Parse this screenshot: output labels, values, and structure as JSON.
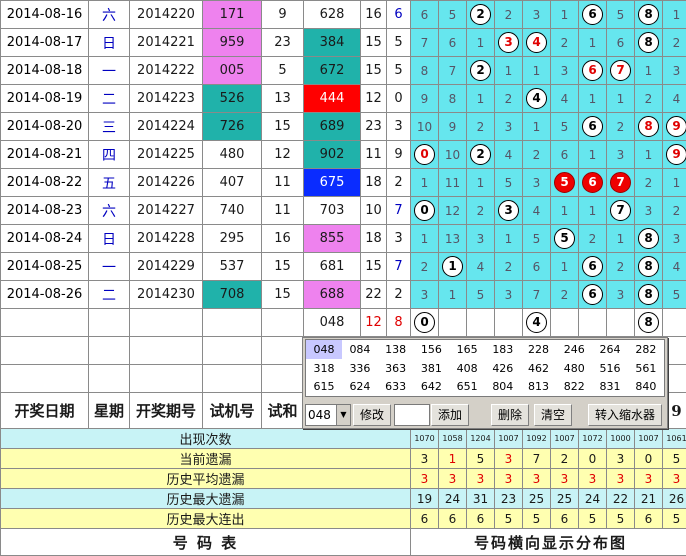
{
  "rows": [
    {
      "date": "2014-08-16",
      "week": "六",
      "issue": "2014220",
      "test": "171",
      "test_bg": "mg",
      "sum": "9",
      "draw": "628",
      "draw_bg": "",
      "span1": "16",
      "span2": "6",
      "span2_c": "blu",
      "cells": [
        [
          "6",
          ""
        ],
        [
          "5",
          ""
        ],
        [
          "2",
          "w"
        ],
        [
          "2",
          ""
        ],
        [
          "3",
          ""
        ],
        [
          "1",
          ""
        ],
        [
          "6",
          "w"
        ],
        [
          "5",
          ""
        ],
        [
          "8",
          "w"
        ],
        [
          "1",
          ""
        ]
      ]
    },
    {
      "date": "2014-08-17",
      "week": "日",
      "issue": "2014221",
      "test": "959",
      "test_bg": "mg",
      "sum": "23",
      "draw": "384",
      "draw_bg": "tl",
      "span1": "15",
      "span2": "5",
      "span2_c": "",
      "cells": [
        [
          "7",
          ""
        ],
        [
          "6",
          ""
        ],
        [
          "1",
          ""
        ],
        [
          "3",
          "wr"
        ],
        [
          "4",
          "wr"
        ],
        [
          "2",
          ""
        ],
        [
          "1",
          ""
        ],
        [
          "6",
          ""
        ],
        [
          "8",
          "w"
        ],
        [
          "2",
          ""
        ]
      ]
    },
    {
      "date": "2014-08-18",
      "week": "一",
      "issue": "2014222",
      "test": "005",
      "test_bg": "mg",
      "sum": "5",
      "draw": "672",
      "draw_bg": "tl",
      "span1": "15",
      "span2": "5",
      "span2_c": "",
      "cells": [
        [
          "8",
          ""
        ],
        [
          "7",
          ""
        ],
        [
          "2",
          "w"
        ],
        [
          "1",
          ""
        ],
        [
          "1",
          ""
        ],
        [
          "3",
          ""
        ],
        [
          "6",
          "wr"
        ],
        [
          "7",
          "wr"
        ],
        [
          "1",
          ""
        ],
        [
          "3",
          ""
        ]
      ]
    },
    {
      "date": "2014-08-19",
      "week": "二",
      "issue": "2014223",
      "test": "526",
      "test_bg": "tl",
      "sum": "13",
      "draw": "444",
      "draw_bg": "rd",
      "span1": "12",
      "span2": "0",
      "span2_c": "",
      "cells": [
        [
          "9",
          ""
        ],
        [
          "8",
          ""
        ],
        [
          "1",
          ""
        ],
        [
          "2",
          ""
        ],
        [
          "4",
          "w"
        ],
        [
          "4",
          ""
        ],
        [
          "1",
          ""
        ],
        [
          "1",
          ""
        ],
        [
          "2",
          ""
        ],
        [
          "4",
          ""
        ]
      ]
    },
    {
      "date": "2014-08-20",
      "week": "三",
      "issue": "2014224",
      "test": "726",
      "test_bg": "tl",
      "sum": "15",
      "draw": "689",
      "draw_bg": "tl",
      "span1": "23",
      "span2": "3",
      "span2_c": "",
      "cells": [
        [
          "10",
          ""
        ],
        [
          "9",
          ""
        ],
        [
          "2",
          ""
        ],
        [
          "3",
          ""
        ],
        [
          "1",
          ""
        ],
        [
          "5",
          ""
        ],
        [
          "6",
          "w"
        ],
        [
          "2",
          ""
        ],
        [
          "8",
          "wr"
        ],
        [
          "9",
          "wr"
        ]
      ]
    },
    {
      "date": "2014-08-21",
      "week": "四",
      "issue": "2014225",
      "test": "480",
      "test_bg": "",
      "sum": "12",
      "draw": "902",
      "draw_bg": "tl",
      "span1": "11",
      "span2": "9",
      "span2_c": "",
      "cells": [
        [
          "0",
          "wr"
        ],
        [
          "10",
          ""
        ],
        [
          "2",
          "w"
        ],
        [
          "4",
          ""
        ],
        [
          "2",
          ""
        ],
        [
          "6",
          ""
        ],
        [
          "1",
          ""
        ],
        [
          "3",
          ""
        ],
        [
          "1",
          ""
        ],
        [
          "9",
          "wr"
        ]
      ]
    },
    {
      "date": "2014-08-22",
      "week": "五",
      "issue": "2014226",
      "test": "407",
      "test_bg": "",
      "sum": "11",
      "draw": "675",
      "draw_bg": "bl",
      "span1": "18",
      "span2": "2",
      "span2_c": "",
      "cells": [
        [
          "1",
          ""
        ],
        [
          "11",
          ""
        ],
        [
          "1",
          ""
        ],
        [
          "5",
          ""
        ],
        [
          "3",
          ""
        ],
        [
          "5",
          "r"
        ],
        [
          "6",
          "r"
        ],
        [
          "7",
          "r"
        ],
        [
          "2",
          ""
        ],
        [
          "1",
          ""
        ]
      ]
    },
    {
      "date": "2014-08-23",
      "week": "六",
      "issue": "2014227",
      "test": "740",
      "test_bg": "",
      "sum": "11",
      "draw": "703",
      "draw_bg": "",
      "span1": "10",
      "span2": "7",
      "span2_c": "blu",
      "cells": [
        [
          "0",
          "w"
        ],
        [
          "12",
          ""
        ],
        [
          "2",
          ""
        ],
        [
          "3",
          "w"
        ],
        [
          "4",
          ""
        ],
        [
          "1",
          ""
        ],
        [
          "1",
          ""
        ],
        [
          "7",
          "w"
        ],
        [
          "3",
          ""
        ],
        [
          "2",
          ""
        ]
      ]
    },
    {
      "date": "2014-08-24",
      "week": "日",
      "issue": "2014228",
      "test": "295",
      "test_bg": "",
      "sum": "16",
      "draw": "855",
      "draw_bg": "mg",
      "span1": "18",
      "span2": "3",
      "span2_c": "",
      "cells": [
        [
          "1",
          ""
        ],
        [
          "13",
          ""
        ],
        [
          "3",
          ""
        ],
        [
          "1",
          ""
        ],
        [
          "5",
          ""
        ],
        [
          "5",
          "w"
        ],
        [
          "2",
          ""
        ],
        [
          "1",
          ""
        ],
        [
          "8",
          "w"
        ],
        [
          "3",
          ""
        ]
      ]
    },
    {
      "date": "2014-08-25",
      "week": "一",
      "issue": "2014229",
      "test": "537",
      "test_bg": "",
      "sum": "15",
      "draw": "681",
      "draw_bg": "",
      "span1": "15",
      "span2": "7",
      "span2_c": "blu",
      "cells": [
        [
          "2",
          ""
        ],
        [
          "1",
          "w"
        ],
        [
          "4",
          ""
        ],
        [
          "2",
          ""
        ],
        [
          "6",
          ""
        ],
        [
          "1",
          ""
        ],
        [
          "6",
          "w"
        ],
        [
          "2",
          ""
        ],
        [
          "8",
          "w"
        ],
        [
          "4",
          ""
        ]
      ]
    },
    {
      "date": "2014-08-26",
      "week": "二",
      "issue": "2014230",
      "test": "708",
      "test_bg": "tl",
      "sum": "15",
      "draw": "688",
      "draw_bg": "mg",
      "span1": "22",
      "span2": "2",
      "span2_c": "",
      "cells": [
        [
          "3",
          ""
        ],
        [
          "1",
          ""
        ],
        [
          "5",
          ""
        ],
        [
          "3",
          ""
        ],
        [
          "7",
          ""
        ],
        [
          "2",
          ""
        ],
        [
          "6",
          "w"
        ],
        [
          "3",
          ""
        ],
        [
          "8",
          "w"
        ],
        [
          "5",
          ""
        ]
      ]
    }
  ],
  "pred": {
    "draw": "048",
    "span1": "12",
    "span2": "8",
    "cells": [
      [
        "0",
        "w"
      ],
      [
        "",
        ""
      ],
      [
        "",
        ""
      ],
      [
        "",
        ""
      ],
      [
        "4",
        "w"
      ],
      [
        "",
        ""
      ],
      [
        "",
        ""
      ],
      [
        "",
        ""
      ],
      [
        "8",
        "w"
      ],
      [
        "",
        ""
      ]
    ]
  },
  "header": {
    "date": "开奖日期",
    "week": "星期",
    "issue": "开奖期号",
    "test": "试机号",
    "sum": "试和",
    "tail": "9"
  },
  "stats": [
    {
      "label": "出现次数",
      "style": "cyl",
      "values": [
        "1070",
        "1058",
        "1204",
        "1007",
        "1092",
        "1007",
        "1072",
        "1000",
        "1007",
        "1061"
      ]
    },
    {
      "label": "当前遗漏",
      "style": "yel",
      "values": [
        "3",
        "1",
        "5",
        "3",
        "7",
        "2",
        "0",
        "3",
        "0",
        "5"
      ]
    },
    {
      "label": "历史平均遗漏",
      "style": "yel",
      "values": [
        "3",
        "3",
        "3",
        "3",
        "3",
        "3",
        "3",
        "3",
        "3",
        "3"
      ]
    },
    {
      "label": "历史最大遗漏",
      "style": "cyl",
      "values": [
        "19",
        "24",
        "31",
        "23",
        "25",
        "25",
        "24",
        "22",
        "21",
        "26"
      ]
    },
    {
      "label": "历史最大连出",
      "style": "yel",
      "values": [
        "6",
        "6",
        "6",
        "5",
        "5",
        "6",
        "5",
        "5",
        "6",
        "5"
      ]
    }
  ],
  "stats_colors": [
    [
      "",
      "",
      "",
      "",
      "",
      "",
      "",
      "",
      "",
      ""
    ],
    [
      "",
      "red",
      "",
      "red",
      "",
      "",
      "",
      "",
      "",
      ""
    ],
    [
      "red",
      "red",
      "red",
      "red",
      "red",
      "red",
      "red",
      "red",
      "red",
      "red"
    ],
    [
      "",
      "",
      "",
      "",
      "",
      "",
      "",
      "",
      "",
      ""
    ],
    [
      "",
      "",
      "",
      "",
      "",
      "",
      "",
      "",
      "",
      ""
    ]
  ],
  "footer": {
    "left": "号 码 表",
    "right": "号码横向显示分布图"
  },
  "popup": {
    "grid": [
      [
        "048",
        "084",
        "138",
        "156",
        "165",
        "183",
        "228",
        "246",
        "264",
        "282"
      ],
      [
        "318",
        "336",
        "363",
        "381",
        "408",
        "426",
        "462",
        "480",
        "516",
        "561"
      ],
      [
        "615",
        "624",
        "633",
        "642",
        "651",
        "804",
        "813",
        "822",
        "831",
        "840"
      ]
    ],
    "select_value": "048",
    "input_value": "",
    "btn_modify": "修改",
    "btn_add": "添加",
    "btn_delete": "删除",
    "btn_clear": "清空",
    "btn_shrink": "转入缩水器"
  }
}
